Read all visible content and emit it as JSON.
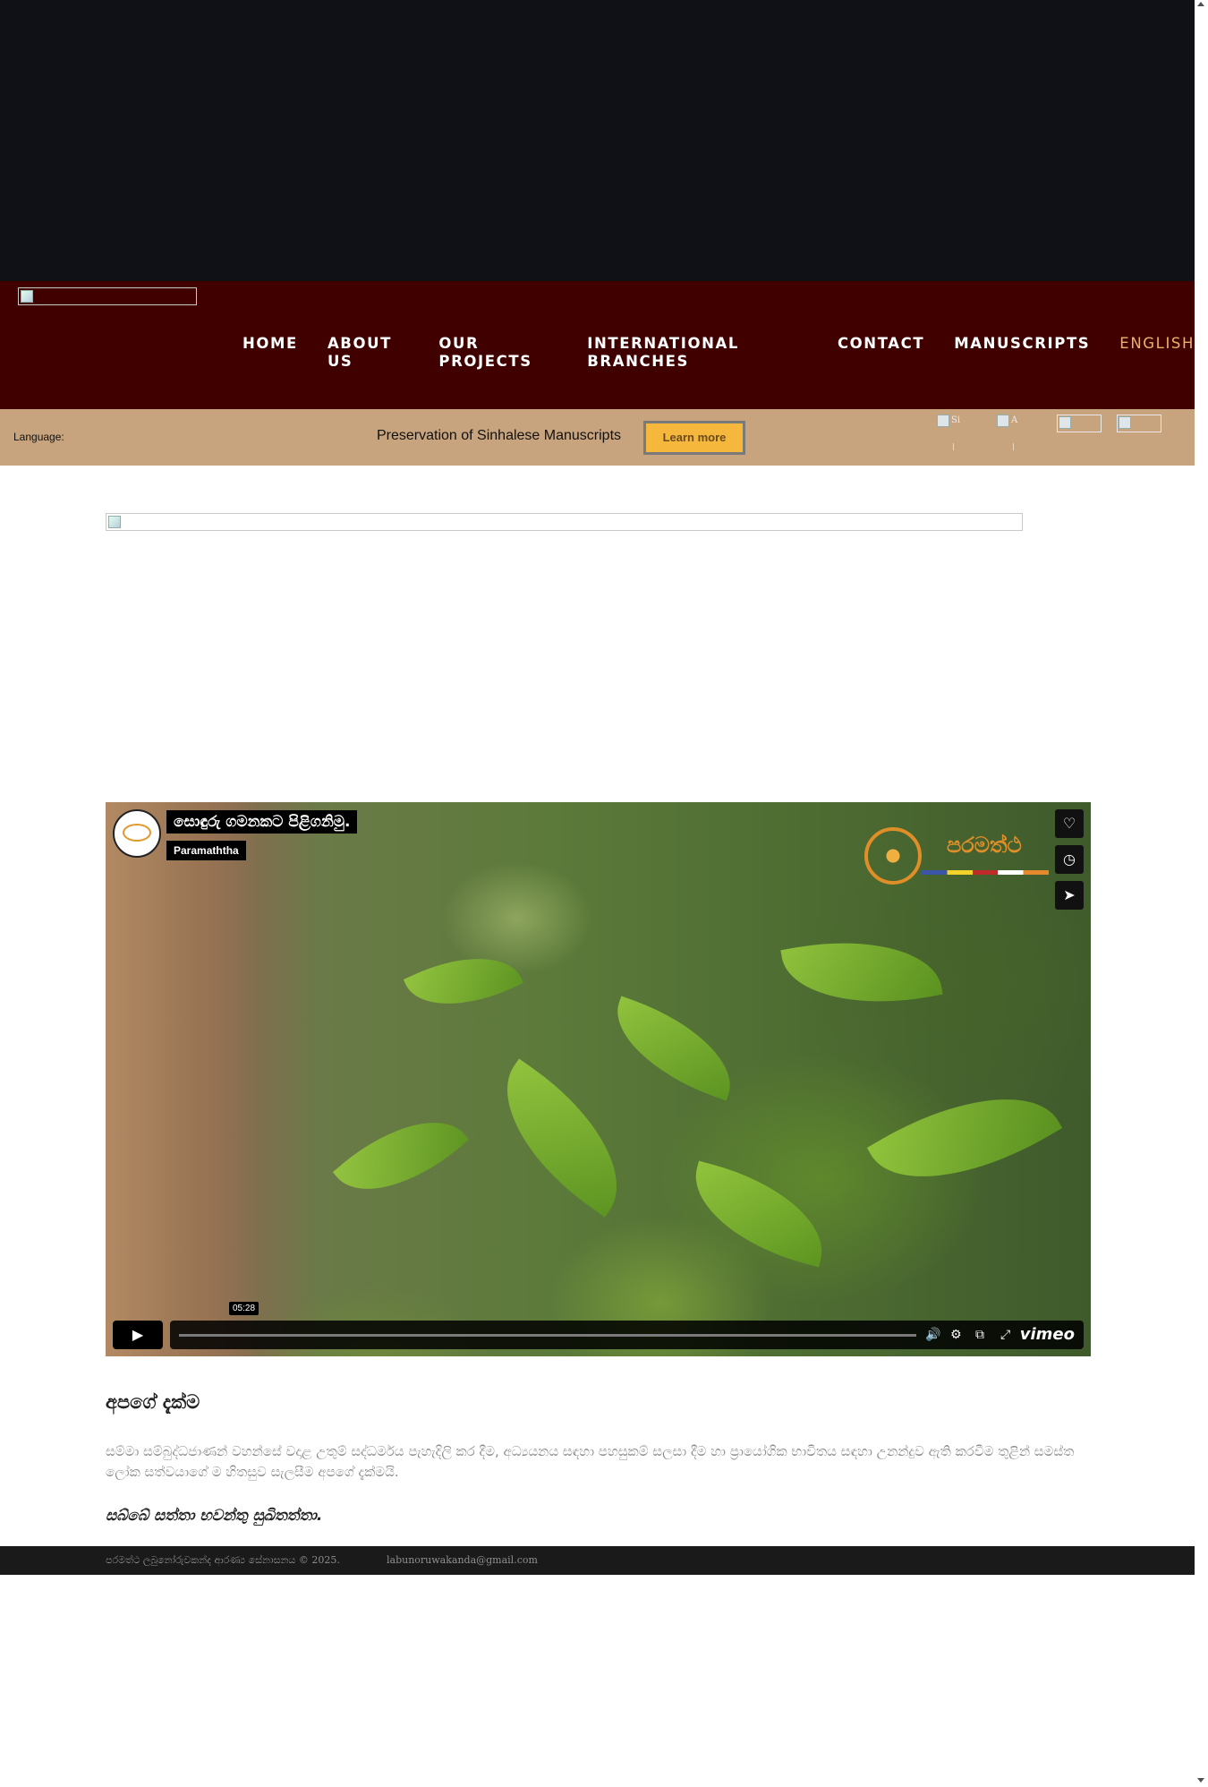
{
  "nav": {
    "items": [
      {
        "label": "HOME"
      },
      {
        "label": "ABOUT US"
      },
      {
        "label": "OUR PROJECTS"
      },
      {
        "label": "INTERNATIONAL BRANCHES"
      },
      {
        "label": "CONTACT"
      },
      {
        "label": "MANUSCRIPTS"
      },
      {
        "label": "ENGLISH"
      }
    ],
    "active_color": "#e8b368"
  },
  "announcement": {
    "language_label": "Language:",
    "text": "Preservation of Sinhalese Manuscripts",
    "button_label": "Learn more",
    "flags": [
      {
        "alt": "Si"
      },
      {
        "alt": "A"
      },
      {
        "alt": ""
      },
      {
        "alt": ""
      }
    ]
  },
  "video": {
    "title": "සොඳුරු ගමනකට පිළිගනිමු.",
    "channel": "Paramaththa",
    "logo_text": "පරමත්ථ",
    "duration": "05:28",
    "brand": "vimeo",
    "icons": [
      "heart-icon",
      "clock-icon",
      "send-icon",
      "play-icon",
      "volume-icon",
      "settings-icon",
      "pip-icon",
      "fullscreen-icon"
    ]
  },
  "vision": {
    "title": "අපගේ දැක්ම",
    "body": "සම්මා සම්බුද්ධජාණන් වහන්සේ වදාළ උතුම් සද්ධර්මය පැහැදිලි කර දීම, අධ්‍යයනය සඳහා පහසුකම් සලසා දීම හා ප්‍රායෝගික භාවිතය සඳහා උනන්දුව ඇති කරවීම තුළින් සමස්ත ලෝක සත්වයාගේ ම හිතසුව සැලසීම අපගේ දැක්මයි.",
    "blessing": "සබ්බේ සත්තා භවන්තු සුඛිතත්තා."
  },
  "footer": {
    "copyright": "පරමත්ථ ලබුනෝරුවකන්ද ආරණ්‍ය සේනාසනය © 2025.",
    "email": "labunoruwakanda@gmail.com"
  },
  "colors": {
    "top_band": "#0f1117",
    "header": "#400000",
    "bar": "#c8a47e",
    "button": "#f5b83c",
    "footer": "#1a1a1a"
  }
}
